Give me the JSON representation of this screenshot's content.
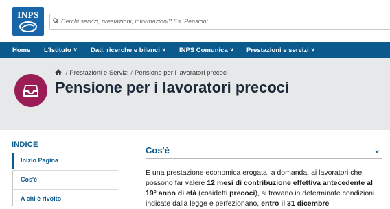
{
  "brand": {
    "logo_text": "INPS"
  },
  "search": {
    "placeholder": "Cerchi servizi, prestazioni, informazioni? Es. Pensioni"
  },
  "nav": {
    "items": [
      {
        "label": "Home"
      },
      {
        "label": "L'Istituto"
      },
      {
        "label": "Dati, ricerche e bilanci"
      },
      {
        "label": "INPS Comunica"
      },
      {
        "label": "Prestazioni e servizi"
      }
    ]
  },
  "breadcrumb": {
    "separator": "/",
    "items": [
      "Prestazioni e Servizi",
      "Pensione per i lavoratori precoci"
    ]
  },
  "page": {
    "title": "Pensione per i lavoratori precoci"
  },
  "indice": {
    "title": "INDICE",
    "items": [
      {
        "label": "Inizio Pagina"
      },
      {
        "label": "Cos'è"
      },
      {
        "label": "A chi è rivolto"
      }
    ]
  },
  "section": {
    "title": "Cos'è",
    "close_symbol": "×",
    "text": {
      "p1": "È una prestazione economica erogata, a domanda, ai lavoratori che possono far valere ",
      "b1": "12 mesi di contribuzione effettiva antecedente al 19° anno di età",
      "p2": " (cosidetti ",
      "b2": "precoci",
      "p3": "), si trovano in determinate condizioni indicate dalla legge e perfezionano, ",
      "b3": "entro il 31 dicembre"
    }
  },
  "colors": {
    "nav_bg": "#0b5a8e",
    "logo_bg": "#1865a8",
    "hero_icon_bg": "#9a1e55",
    "hero_bg": "#e7e8e9"
  }
}
